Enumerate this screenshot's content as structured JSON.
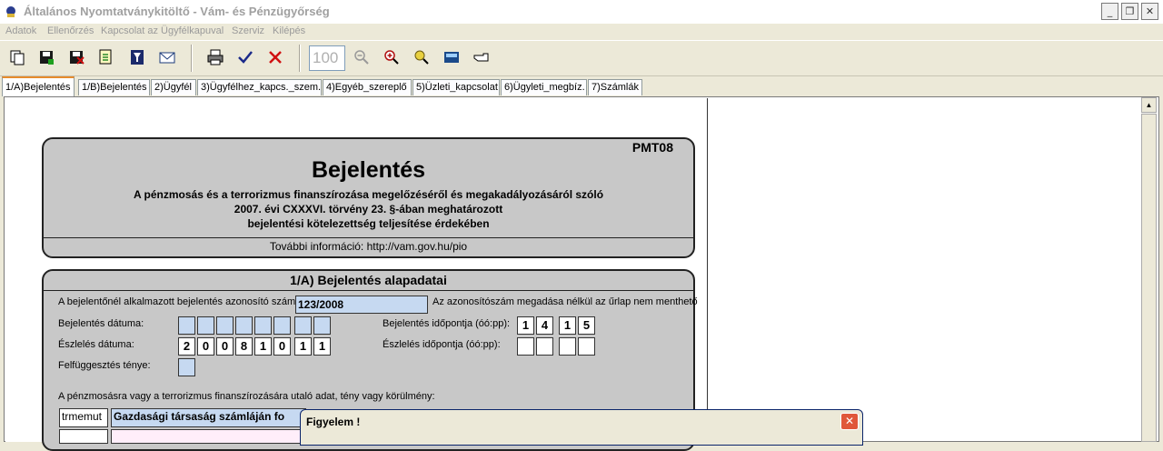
{
  "window": {
    "title": "Általános Nyomtatványkitöltő - Vám- és Pénzügyőrség",
    "minimize": "_",
    "restore": "❐",
    "close": "✕"
  },
  "menu": [
    "Adatok",
    "Ellenőrzés",
    "Kapcsolat az Ügyfélkapuval",
    "Szerviz",
    "Kilépés"
  ],
  "toolbar": {
    "zoom": "100"
  },
  "tabs": [
    "1/A)Bejelentés",
    "1/B)Bejelentés",
    "2)Ügyfél",
    "3)Ügyfélhez_kapcs._szem.",
    "4)Egyéb_szereplő",
    "5)Üzleti_kapcsolat",
    "6)Ügyleti_megbíz.",
    "7)Számlák"
  ],
  "header": {
    "code": "PMT08",
    "title": "Bejelentés",
    "line1": "A pénzmosás és a terrorizmus finanszírozása megelőzéséről és megakadályozásáról szóló",
    "line2": "2007. évi CXXXVI. törvény 23. §-ában meghatározott",
    "line3": "bejelentési kötelezettség teljesítése érdekében",
    "info": "További információ: http://vam.gov.hu/pio"
  },
  "section": {
    "title": "1/A) Bejelentés alapadatai",
    "id_label": "A bejelentőnél alkalmazott bejelentés azonosító szám:",
    "id_value": "123/2008",
    "id_note": "Az azonosítószám megadása nélkül az űrlap nem menthető",
    "date_label": "Bejelentés dátuma:",
    "time_label": "Bejelentés időpontja (óó:pp):",
    "time_digits": [
      "1",
      "4",
      "1",
      "5"
    ],
    "detect_date_label": "Észlelés dátuma:",
    "detect_date_digits": [
      "2",
      "0",
      "0",
      "8",
      "1",
      "0",
      "1",
      "1"
    ],
    "detect_time_label": "Észlelés időpontja (óó:pp):",
    "suspend_label": "Felfüggesztés ténye:",
    "indicator_label": "A pénzmosásra vagy a terrorizmus finanszírozására utaló adat, tény vagy körülmény:",
    "code_value": "trmemut",
    "desc_value": "Gazdasági társaság számláján fo"
  },
  "dialog": {
    "title": "Figyelem !",
    "close": "✕"
  },
  "colors": {
    "panel": "#c8c8c8",
    "field": "#c6d9f1",
    "active_tab": "#e68b2c"
  }
}
